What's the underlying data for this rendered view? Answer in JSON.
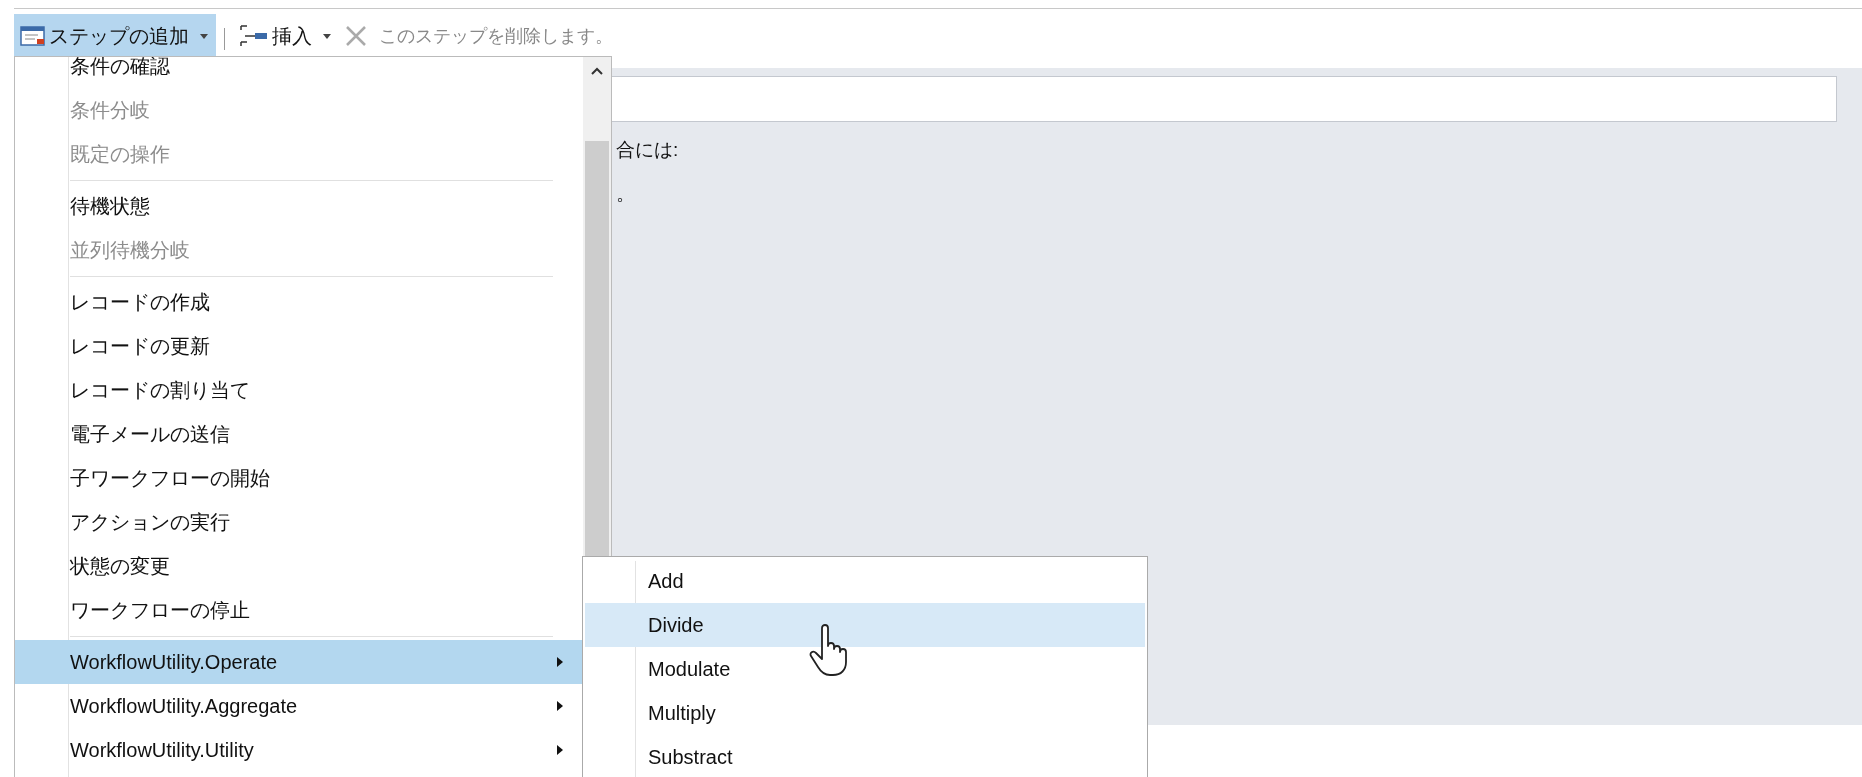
{
  "toolbar": {
    "add_step": {
      "label": "ステップの追加",
      "expanded": true
    },
    "insert": {
      "label": "挿入"
    },
    "delete": {
      "label": "このステップを削除します。",
      "disabled": true
    }
  },
  "content": {
    "texts": [
      "合には:",
      "。"
    ]
  },
  "menu": {
    "items": [
      {
        "kind": "item",
        "label": "条件の確認",
        "disabled": false,
        "selected": false,
        "submenu": false
      },
      {
        "kind": "item",
        "label": "条件分岐",
        "disabled": true,
        "selected": false,
        "submenu": false
      },
      {
        "kind": "item",
        "label": "既定の操作",
        "disabled": true,
        "selected": false,
        "submenu": false
      },
      {
        "kind": "separator"
      },
      {
        "kind": "item",
        "label": "待機状態",
        "disabled": false,
        "selected": false,
        "submenu": false
      },
      {
        "kind": "item",
        "label": "並列待機分岐",
        "disabled": true,
        "selected": false,
        "submenu": false
      },
      {
        "kind": "separator"
      },
      {
        "kind": "item",
        "label": "レコードの作成",
        "disabled": false,
        "selected": false,
        "submenu": false
      },
      {
        "kind": "item",
        "label": "レコードの更新",
        "disabled": false,
        "selected": false,
        "submenu": false
      },
      {
        "kind": "item",
        "label": "レコードの割り当て",
        "disabled": false,
        "selected": false,
        "submenu": false
      },
      {
        "kind": "item",
        "label": "電子メールの送信",
        "disabled": false,
        "selected": false,
        "submenu": false
      },
      {
        "kind": "item",
        "label": "子ワークフローの開始",
        "disabled": false,
        "selected": false,
        "submenu": false
      },
      {
        "kind": "item",
        "label": "アクションの実行",
        "disabled": false,
        "selected": false,
        "submenu": false
      },
      {
        "kind": "item",
        "label": "状態の変更",
        "disabled": false,
        "selected": false,
        "submenu": false
      },
      {
        "kind": "item",
        "label": "ワークフローの停止",
        "disabled": false,
        "selected": false,
        "submenu": false
      },
      {
        "kind": "separator"
      },
      {
        "kind": "item",
        "label": "WorkflowUtility.Operate",
        "disabled": false,
        "selected": true,
        "submenu": true
      },
      {
        "kind": "item",
        "label": "WorkflowUtility.Aggregate",
        "disabled": false,
        "selected": false,
        "submenu": true
      },
      {
        "kind": "item",
        "label": "WorkflowUtility.Utility",
        "disabled": false,
        "selected": false,
        "submenu": true
      }
    ]
  },
  "submenu": {
    "items": [
      {
        "label": "Add",
        "selected": false
      },
      {
        "label": "Divide",
        "selected": true
      },
      {
        "label": "Modulate",
        "selected": false
      },
      {
        "label": "Multiply",
        "selected": false
      },
      {
        "label": "Substract",
        "selected": false
      }
    ]
  }
}
